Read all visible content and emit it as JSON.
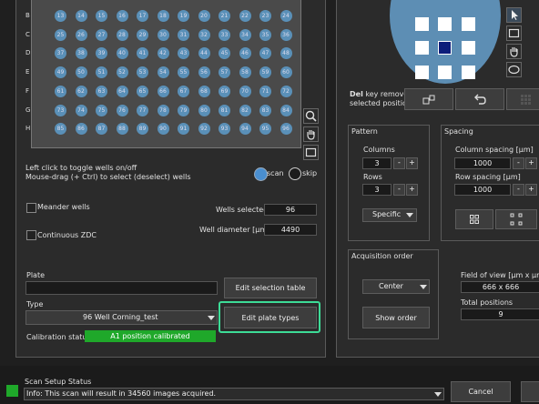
{
  "plate_grid": {
    "row_labels": [
      "B",
      "C",
      "D",
      "E",
      "F",
      "G",
      "H"
    ],
    "rows": [
      [
        "13",
        "14",
        "15",
        "16",
        "17",
        "18",
        "19",
        "20",
        "21",
        "22",
        "23",
        "24"
      ],
      [
        "25",
        "26",
        "27",
        "28",
        "29",
        "30",
        "31",
        "32",
        "33",
        "34",
        "35",
        "36"
      ],
      [
        "37",
        "38",
        "39",
        "40",
        "41",
        "42",
        "43",
        "44",
        "45",
        "46",
        "47",
        "48"
      ],
      [
        "49",
        "50",
        "51",
        "52",
        "53",
        "54",
        "55",
        "56",
        "57",
        "58",
        "59",
        "60"
      ],
      [
        "61",
        "62",
        "63",
        "64",
        "65",
        "66",
        "67",
        "68",
        "69",
        "70",
        "71",
        "72"
      ],
      [
        "73",
        "74",
        "75",
        "76",
        "77",
        "78",
        "79",
        "80",
        "81",
        "82",
        "83",
        "84"
      ],
      [
        "85",
        "86",
        "87",
        "88",
        "89",
        "90",
        "91",
        "92",
        "93",
        "94",
        "95",
        "96"
      ]
    ],
    "well_color": "#5a90b8"
  },
  "hints": {
    "line1": "Left click to toggle wells on/off",
    "line2": "Mouse-drag (+ Ctrl) to select (deselect) wells"
  },
  "mode": {
    "scan": "scan",
    "skip": "skip"
  },
  "options": {
    "meander": "Meander wells",
    "zdc": "Continuous ZDC"
  },
  "wells_selected": {
    "label": "Wells selected",
    "value": "96"
  },
  "well_diameter": {
    "label": "Well diameter [µm]",
    "value": "4490"
  },
  "plate": {
    "label": "Plate",
    "value": "",
    "edit_table": "Edit selection table"
  },
  "type": {
    "label": "Type",
    "value": "96  Well Corning_test",
    "edit_types": "Edit plate types"
  },
  "calibration": {
    "label": "Calibration status:",
    "value": "A1 position calibrated",
    "color": "#1fa82a"
  },
  "del_hint": {
    "key": "Del",
    "rest": " key removes",
    "line2": "selected positions"
  },
  "pattern": {
    "title": "Pattern",
    "columns_label": "Columns",
    "columns_value": "3",
    "rows_label": "Rows",
    "rows_value": "3",
    "mode_value": "Specific"
  },
  "spacing": {
    "title": "Spacing",
    "col_label": "Column spacing [µm]",
    "col_value": "1000",
    "row_label": "Row spacing [µm]",
    "row_value": "1000"
  },
  "acquisition": {
    "title": "Acquisition order",
    "value": "Center",
    "show": "Show order"
  },
  "fov": {
    "label": "Field of view [µm x µm]",
    "value": "666 x 666"
  },
  "total": {
    "label": "Total positions",
    "value": "9"
  },
  "status": {
    "title": "Scan Setup Status",
    "message": "Info: This scan will result in 34560 images acquired.",
    "cancel": "Cancel"
  },
  "stepper": {
    "minus": "-",
    "plus": "+"
  },
  "highlight_color": "#3ddc97"
}
